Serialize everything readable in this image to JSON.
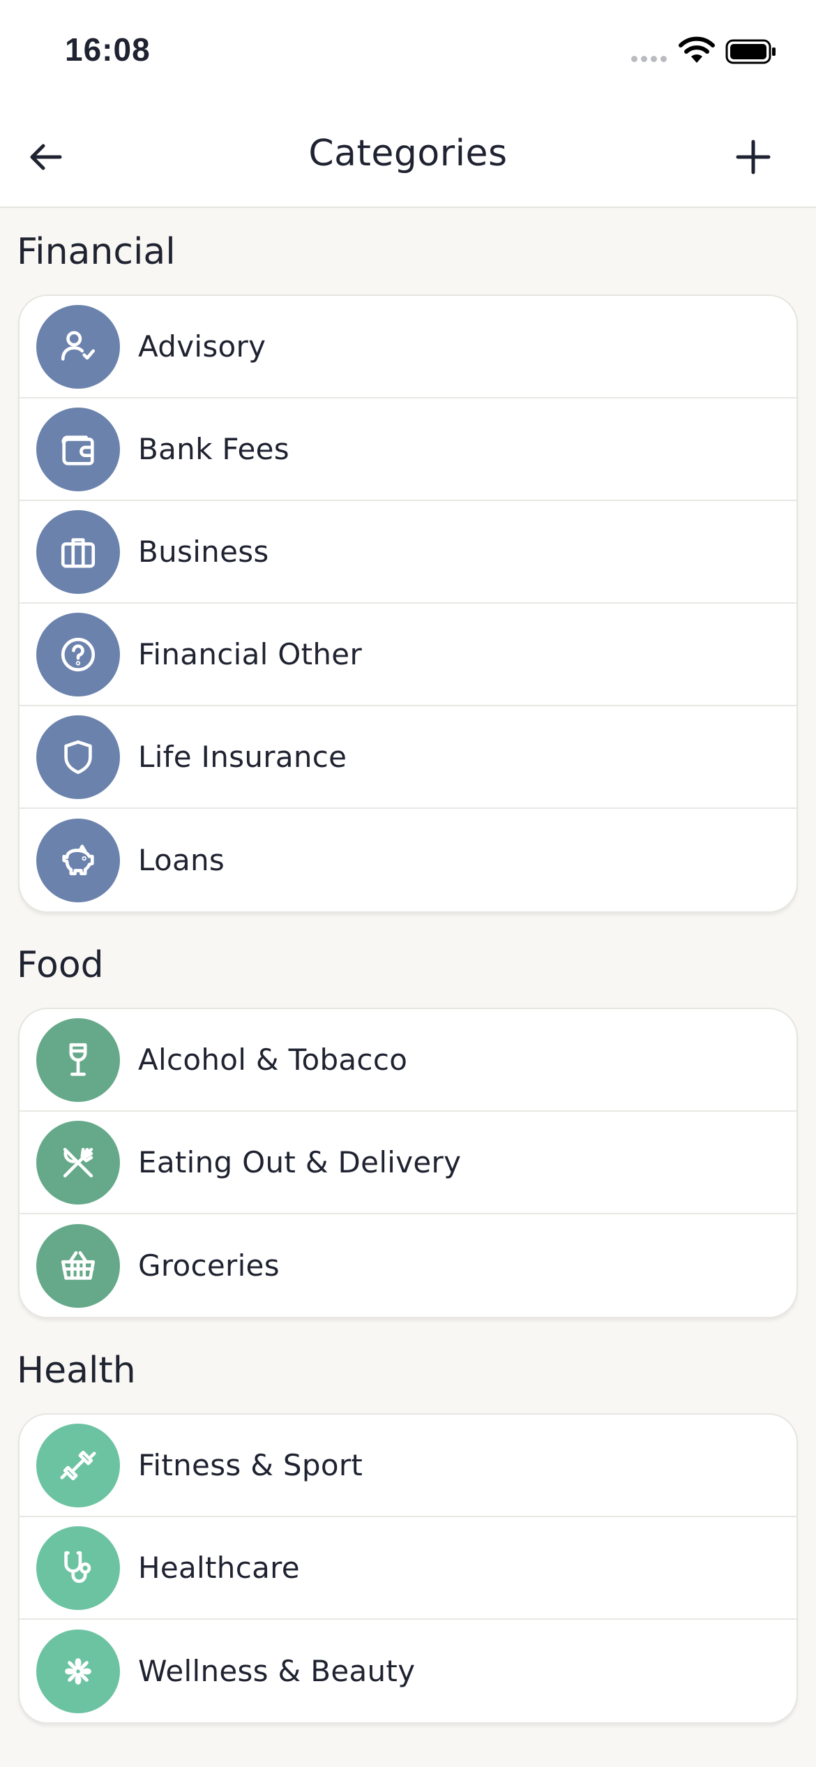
{
  "status": {
    "time": "16:08"
  },
  "header": {
    "title": "Categories"
  },
  "sections": [
    {
      "title": "Financial",
      "color": "#6b82ad",
      "items": [
        {
          "label": "Advisory",
          "icon": "user-check-icon"
        },
        {
          "label": "Bank Fees",
          "icon": "wallet-icon"
        },
        {
          "label": "Business",
          "icon": "briefcase-icon"
        },
        {
          "label": "Financial Other",
          "icon": "question-circle-icon"
        },
        {
          "label": "Life Insurance",
          "icon": "shield-icon"
        },
        {
          "label": "Loans",
          "icon": "piggy-bank-icon"
        }
      ]
    },
    {
      "title": "Food",
      "color": "#66a98a",
      "items": [
        {
          "label": "Alcohol & Tobacco",
          "icon": "wine-glass-icon"
        },
        {
          "label": "Eating Out & Delivery",
          "icon": "fork-knife-icon"
        },
        {
          "label": "Groceries",
          "icon": "basket-icon"
        }
      ]
    },
    {
      "title": "Health",
      "color": "#6cc3a2",
      "items": [
        {
          "label": "Fitness & Sport",
          "icon": "dumbbell-icon"
        },
        {
          "label": "Healthcare",
          "icon": "stethoscope-icon"
        },
        {
          "label": "Wellness & Beauty",
          "icon": "flower-icon"
        }
      ]
    }
  ]
}
